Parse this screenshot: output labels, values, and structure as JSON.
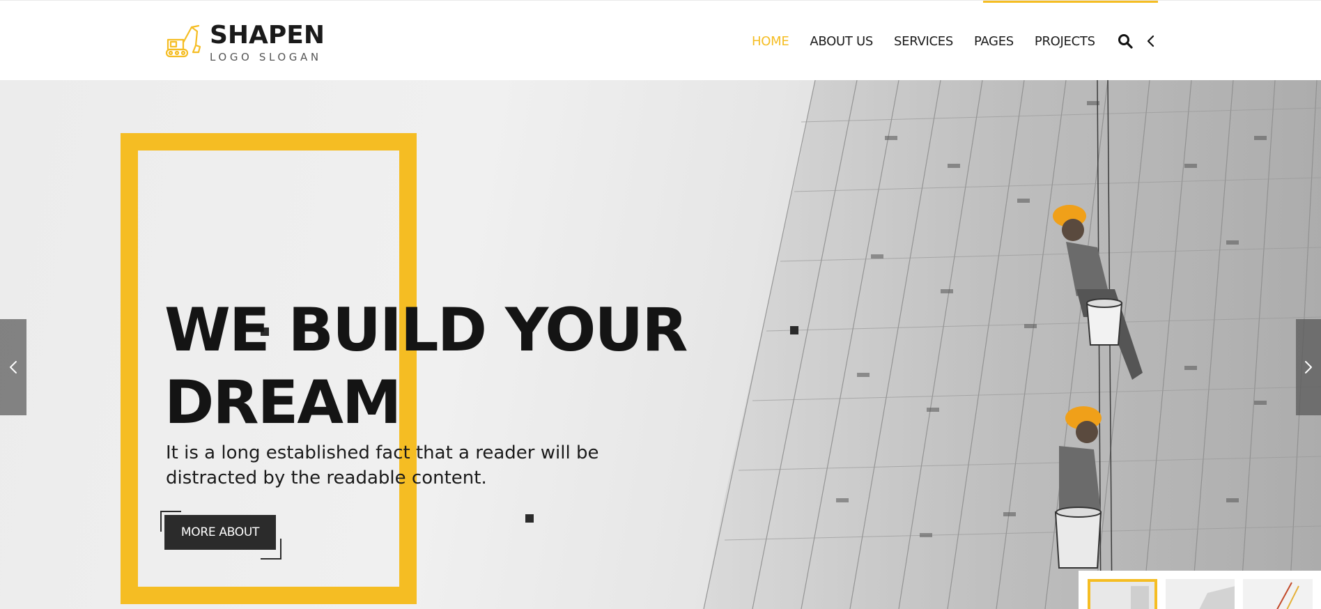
{
  "brand": {
    "name": "SHAPEN",
    "slogan": "LOGO SLOGAN",
    "accent_color": "#f5bd23",
    "dark_color": "#2b2b2b"
  },
  "nav": {
    "items": [
      {
        "label": "HOME",
        "active": true
      },
      {
        "label": "ABOUT US",
        "active": false
      },
      {
        "label": "SERVICES",
        "active": false
      },
      {
        "label": "PAGES",
        "active": false
      },
      {
        "label": "PROJECTS",
        "active": false
      }
    ],
    "icons": [
      "search-icon",
      "chevron-left-icon"
    ]
  },
  "hero": {
    "title_line1": "WE BUILD YOUR",
    "title_line2": "DREAM",
    "description": "It is a long established fact that a reader will be distracted by the readable content.",
    "cta_label": "MORE ABOUT",
    "prev_icon": "chevron-left-icon",
    "next_icon": "chevron-right-icon"
  },
  "thumbnails": [
    {
      "active": true
    },
    {
      "active": false
    },
    {
      "active": false
    }
  ]
}
